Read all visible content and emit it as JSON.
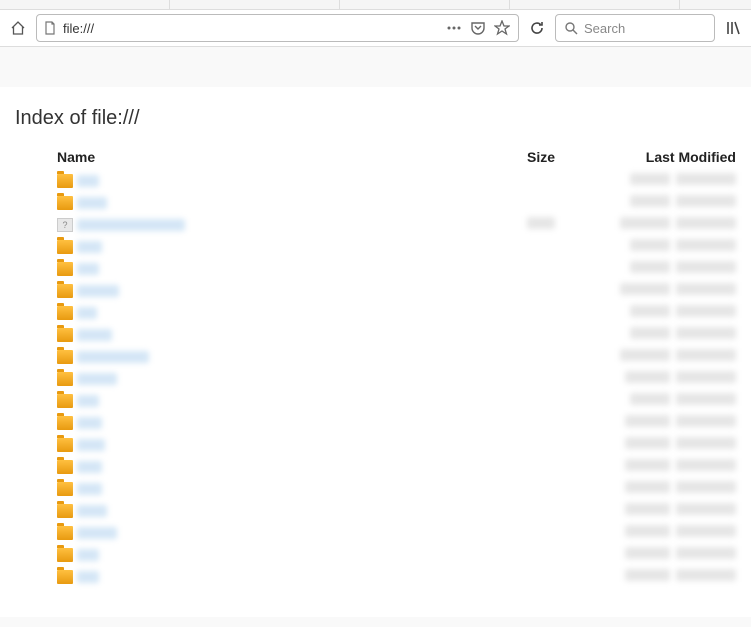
{
  "url_bar": {
    "value": "file:///"
  },
  "search": {
    "placeholder": "Search"
  },
  "page": {
    "title": "Index of file:///"
  },
  "columns": {
    "name": "Name",
    "size": "Size",
    "modified": "Last Modified"
  },
  "rows": [
    {
      "icon": "folder",
      "name_w": 22,
      "size_w": 0,
      "date1_w": 40,
      "date2_w": 60
    },
    {
      "icon": "folder",
      "name_w": 30,
      "size_w": 0,
      "date1_w": 40,
      "date2_w": 60
    },
    {
      "icon": "unknown",
      "name_w": 108,
      "size_w": 28,
      "date1_w": 50,
      "date2_w": 60
    },
    {
      "icon": "folder",
      "name_w": 25,
      "size_w": 0,
      "date1_w": 40,
      "date2_w": 60
    },
    {
      "icon": "folder",
      "name_w": 22,
      "size_w": 0,
      "date1_w": 40,
      "date2_w": 60
    },
    {
      "icon": "folder",
      "name_w": 42,
      "size_w": 0,
      "date1_w": 50,
      "date2_w": 60
    },
    {
      "icon": "folder",
      "name_w": 20,
      "size_w": 0,
      "date1_w": 40,
      "date2_w": 60
    },
    {
      "icon": "folder",
      "name_w": 35,
      "size_w": 0,
      "date1_w": 40,
      "date2_w": 60
    },
    {
      "icon": "folder",
      "name_w": 72,
      "size_w": 0,
      "date1_w": 50,
      "date2_w": 60
    },
    {
      "icon": "folder",
      "name_w": 40,
      "size_w": 0,
      "date1_w": 45,
      "date2_w": 60
    },
    {
      "icon": "folder",
      "name_w": 22,
      "size_w": 0,
      "date1_w": 40,
      "date2_w": 60
    },
    {
      "icon": "folder",
      "name_w": 25,
      "size_w": 0,
      "date1_w": 45,
      "date2_w": 60
    },
    {
      "icon": "folder",
      "name_w": 28,
      "size_w": 0,
      "date1_w": 45,
      "date2_w": 60
    },
    {
      "icon": "folder",
      "name_w": 25,
      "size_w": 0,
      "date1_w": 45,
      "date2_w": 60
    },
    {
      "icon": "folder",
      "name_w": 25,
      "size_w": 0,
      "date1_w": 45,
      "date2_w": 60
    },
    {
      "icon": "folder",
      "name_w": 30,
      "size_w": 0,
      "date1_w": 45,
      "date2_w": 60
    },
    {
      "icon": "folder",
      "name_w": 40,
      "size_w": 0,
      "date1_w": 45,
      "date2_w": 60
    },
    {
      "icon": "folder",
      "name_w": 22,
      "size_w": 0,
      "date1_w": 45,
      "date2_w": 60
    },
    {
      "icon": "folder",
      "name_w": 22,
      "size_w": 0,
      "date1_w": 45,
      "date2_w": 60
    }
  ]
}
